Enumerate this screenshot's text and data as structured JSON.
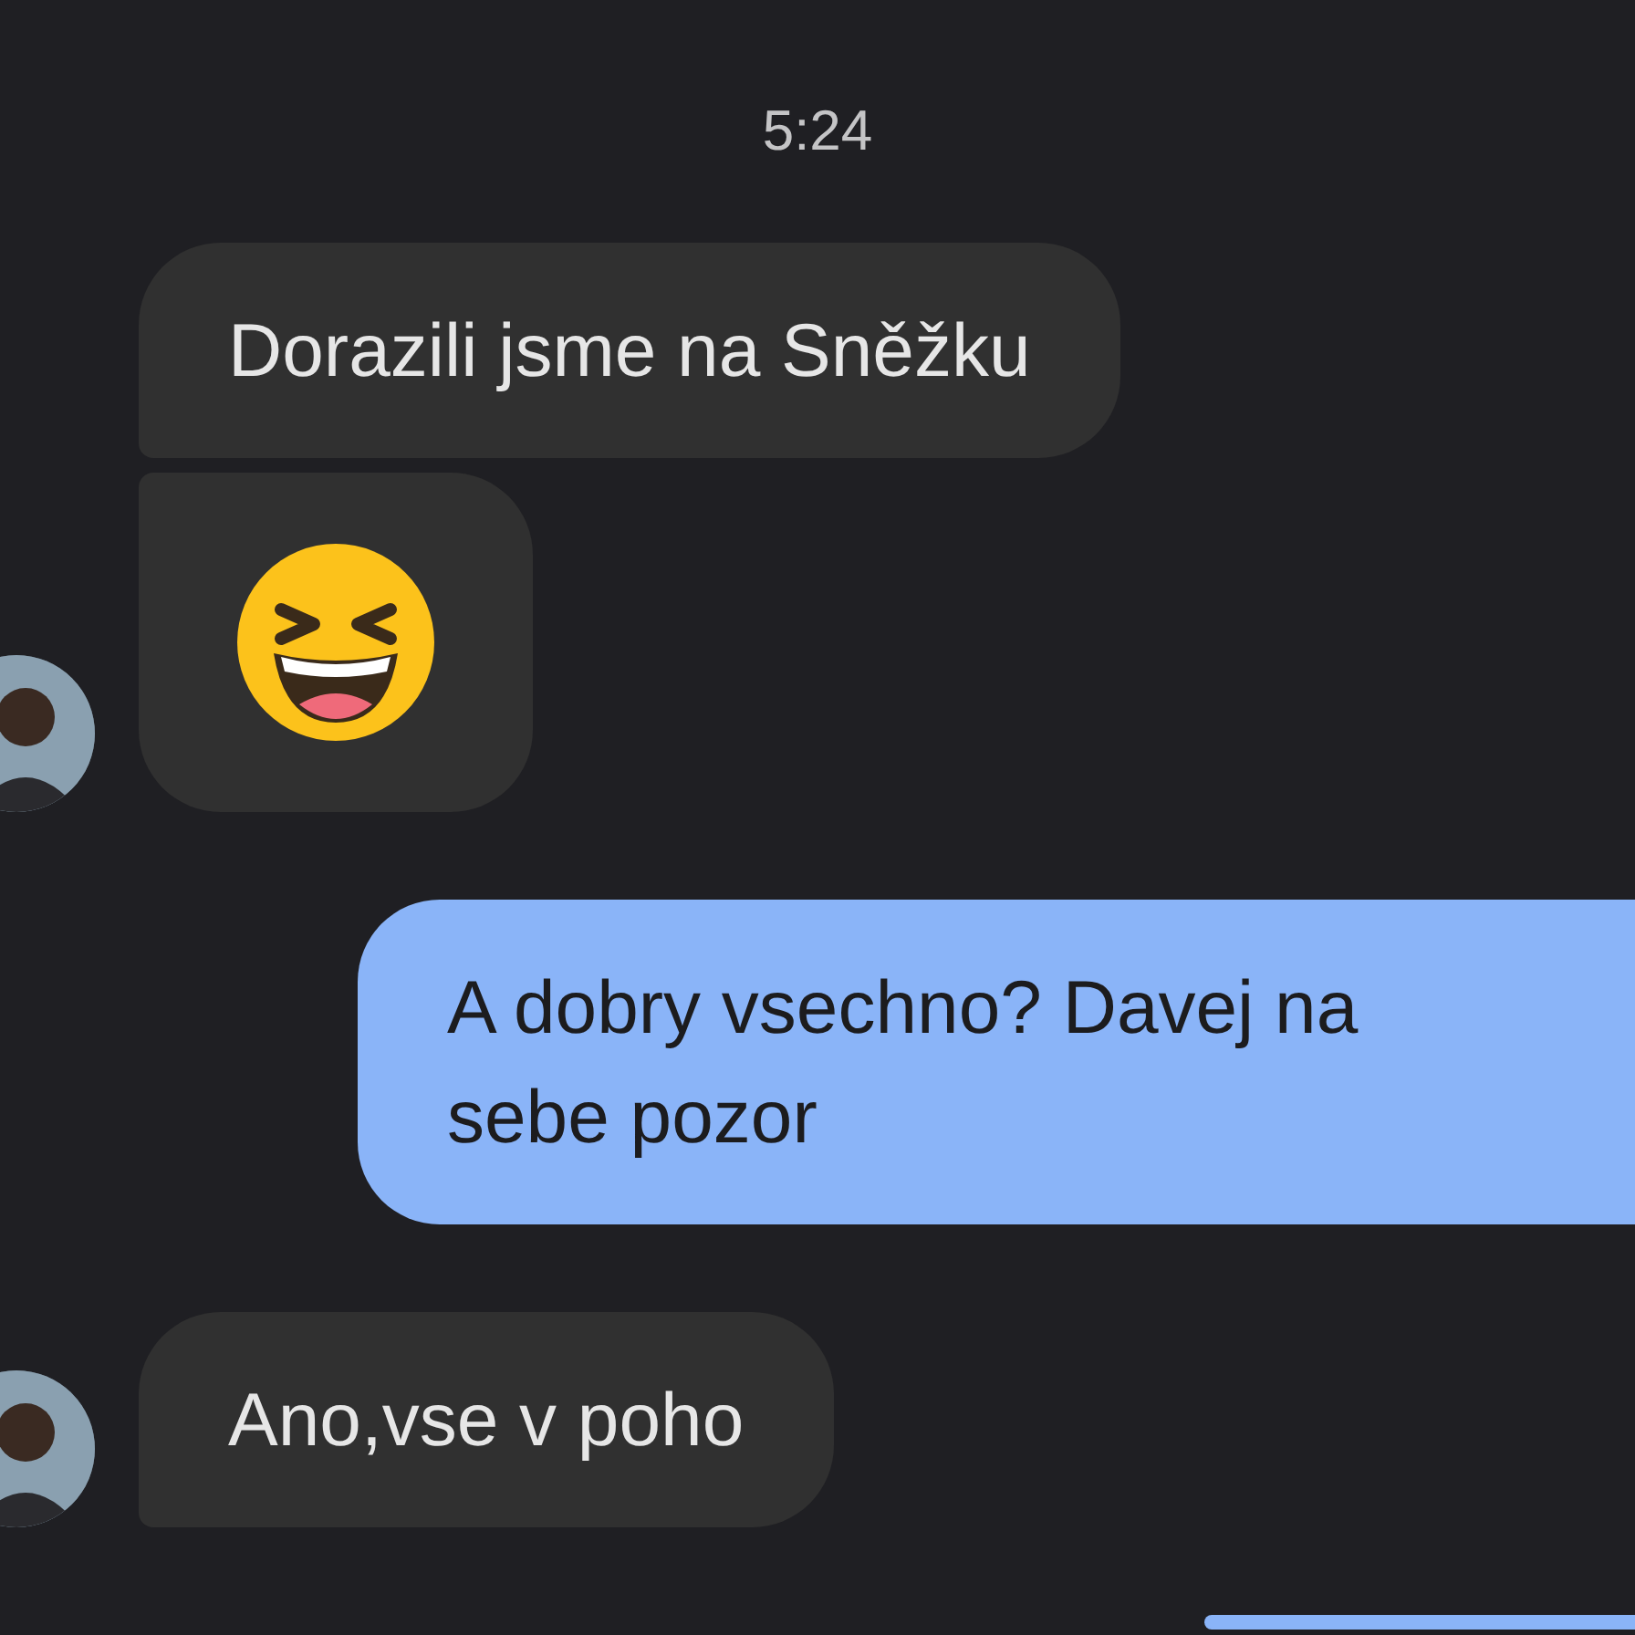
{
  "timestamp": "5:24",
  "messages": [
    {
      "kind": "received-text",
      "text": "Dorazili jsme na Sněžku",
      "avatar": false
    },
    {
      "kind": "received-emoji",
      "avatar": true
    },
    {
      "kind": "sent-text",
      "text": "A dobry vsechno? Davej na sebe pozor"
    },
    {
      "kind": "received-text",
      "text": "Ano,vse v poho",
      "avatar": true
    },
    {
      "kind": "sent-partial"
    }
  ]
}
